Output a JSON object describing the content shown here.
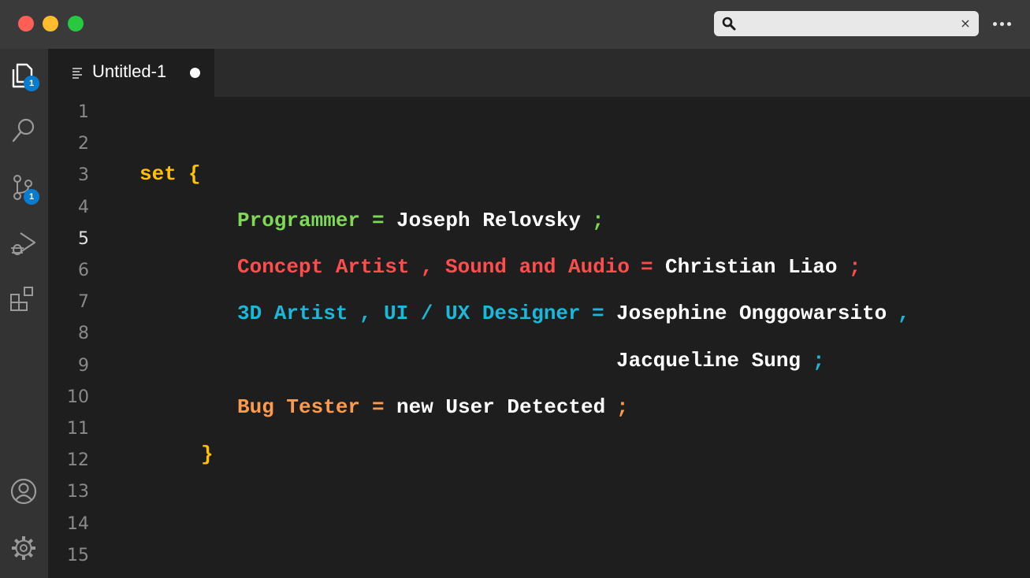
{
  "titlebar": {
    "search": {
      "value": "",
      "placeholder": "",
      "clear_glyph": "×"
    }
  },
  "activity_bar": {
    "explorer_badge": "1",
    "source_control_badge": "1"
  },
  "tab": {
    "label": "Untitled-1"
  },
  "editor": {
    "line_numbers": [
      "1",
      "2",
      "3",
      "4",
      "5",
      "6",
      "7",
      "8",
      "9",
      "10",
      "11",
      "12",
      "13",
      "14",
      "15"
    ],
    "current_line": "5",
    "code": {
      "l3": {
        "kw": "set",
        "brace": "{"
      },
      "l5": {
        "role": "Programmer",
        "eq": "=",
        "name": "Joseph Relovsky",
        "semi": ";"
      },
      "l6": {
        "role1": "Concept Artist",
        "comma": ",",
        "role2": "Sound and Audio",
        "eq": "=",
        "name": "Christian Liao",
        "semi": ";"
      },
      "l7": {
        "role1": "3D Artist",
        "comma": ",",
        "role2": "UI / UX Designer",
        "eq": "=",
        "name": "Josephine Onggowarsito",
        "comma2": ","
      },
      "l9": {
        "name": "Jacqueline Sung",
        "semi": ";"
      },
      "l10": {
        "role": "Bug Tester",
        "eq": "=",
        "name": "new User Detected",
        "semi": ";"
      },
      "l12": {
        "brace": "}"
      }
    }
  },
  "colors": {
    "keyword": "#ffc107",
    "programmer": "#7ed957",
    "artist_audio": "#ff4d4d",
    "designer": "#1cb8d9",
    "tester": "#ff9a4d",
    "badge": "#0a7ccf"
  },
  "icons": [
    "search-icon",
    "close-icon",
    "more-icon",
    "files-icon",
    "search-view-icon",
    "source-control-icon",
    "run-debug-icon",
    "extensions-icon",
    "account-icon",
    "settings-gear-icon",
    "file-lines-icon"
  ]
}
